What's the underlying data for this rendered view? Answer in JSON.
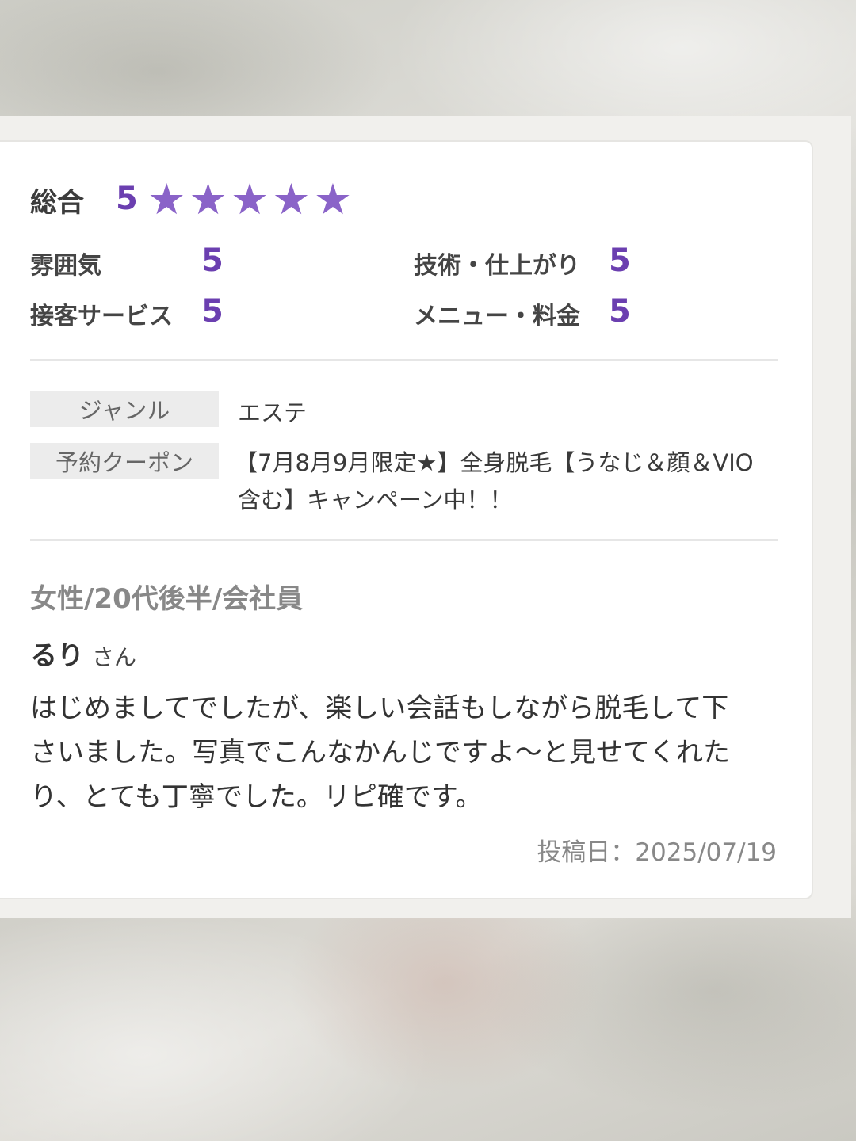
{
  "ratings": {
    "total_label": "総合",
    "total_score": "5",
    "star_count": 5,
    "star_glyph": "★",
    "star_color": "#8a63c8",
    "score_color": "#6b3fb0",
    "categories": [
      {
        "label": "雰囲気",
        "score": "5"
      },
      {
        "label": "技術・仕上がり",
        "score": "5"
      },
      {
        "label": "接客サービス",
        "score": "5"
      },
      {
        "label": "メニュー・料金",
        "score": "5"
      }
    ]
  },
  "details": {
    "genre_label": "ジャンル",
    "genre_value": "エステ",
    "coupon_label": "予約クーポン",
    "coupon_lines": [
      "【7月8月9月限定★】全身脱毛【うなじ＆顔＆VIO",
      "含む】キャンペーン中！！"
    ]
  },
  "review": {
    "profile": "女性/20代後半/会社員",
    "name": "るり",
    "name_suffix": "さん",
    "comment_lines": [
      "はじめましてでしたが、楽しい会話もしながら脱毛して下",
      "さいました。写真でこんなかんじですよ〜と見せてくれた",
      "り、とても丁寧でした。リピ確です。"
    ],
    "post_date": "投稿日：2025/07/19"
  }
}
